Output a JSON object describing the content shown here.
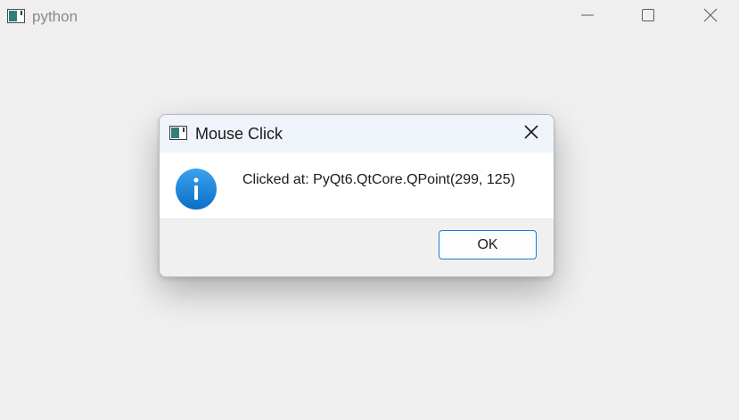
{
  "main_window": {
    "title": "python",
    "controls": {
      "minimize_icon": "minimize-icon",
      "maximize_icon": "maximize-icon",
      "close_icon": "close-icon"
    }
  },
  "dialog": {
    "title": "Mouse Click",
    "icon": "info-icon",
    "message": "Clicked at: PyQt6.QtCore.QPoint(299, 125)",
    "ok_label": "OK",
    "close_icon": "close-icon"
  },
  "colors": {
    "background": "#f0f0f0",
    "dialog_titlebar": "#eff3fa",
    "accent": "#1a7bd4",
    "info_blue": "#1a86d8"
  }
}
